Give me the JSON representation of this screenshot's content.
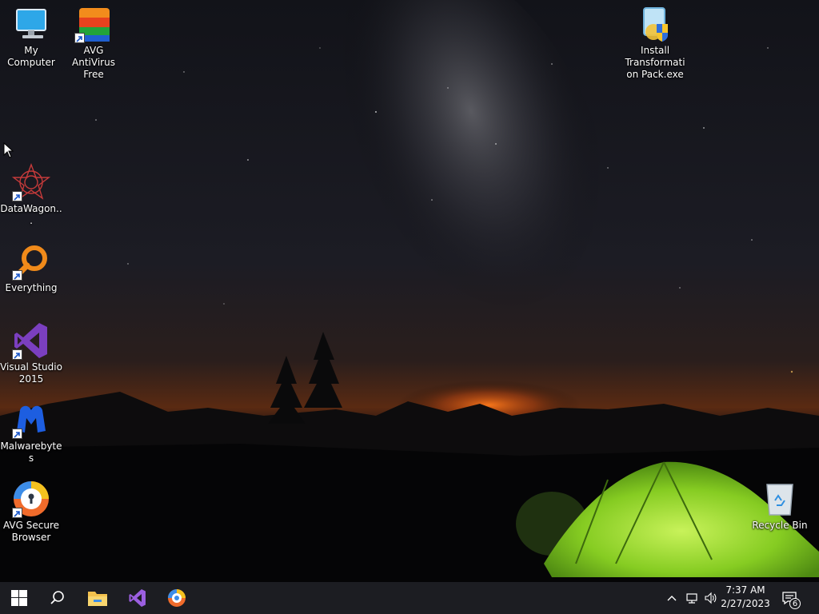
{
  "desktop": {
    "icons": [
      {
        "id": "my-computer",
        "label": "My Computer"
      },
      {
        "id": "avg-antivirus",
        "label": "AVG AntiVirus Free"
      },
      {
        "id": "install-pack",
        "label": "Install Transformation Pack.exe"
      },
      {
        "id": "datawagon",
        "label": "DataWagon..."
      },
      {
        "id": "everything",
        "label": "Everything"
      },
      {
        "id": "visual-studio",
        "label": "Visual Studio 2015"
      },
      {
        "id": "malwarebytes",
        "label": "Malwarebytes"
      },
      {
        "id": "avg-secure-browser",
        "label": "AVG Secure Browser"
      },
      {
        "id": "recycle-bin",
        "label": "Recycle Bin"
      }
    ]
  },
  "taskbar": {
    "pinned": [
      "windows-start-icon",
      "search-icon",
      "file-explorer-icon",
      "visual-studio-icon",
      "avg-secure-browser-icon"
    ],
    "clock": {
      "time": "7:37 AM",
      "date": "2/27/2023"
    },
    "notifications": {
      "count": "6"
    }
  },
  "colors": {
    "taskbar": "#1c1d22",
    "tent": "#8fd42a",
    "horizon_glow": "#e0631a"
  }
}
